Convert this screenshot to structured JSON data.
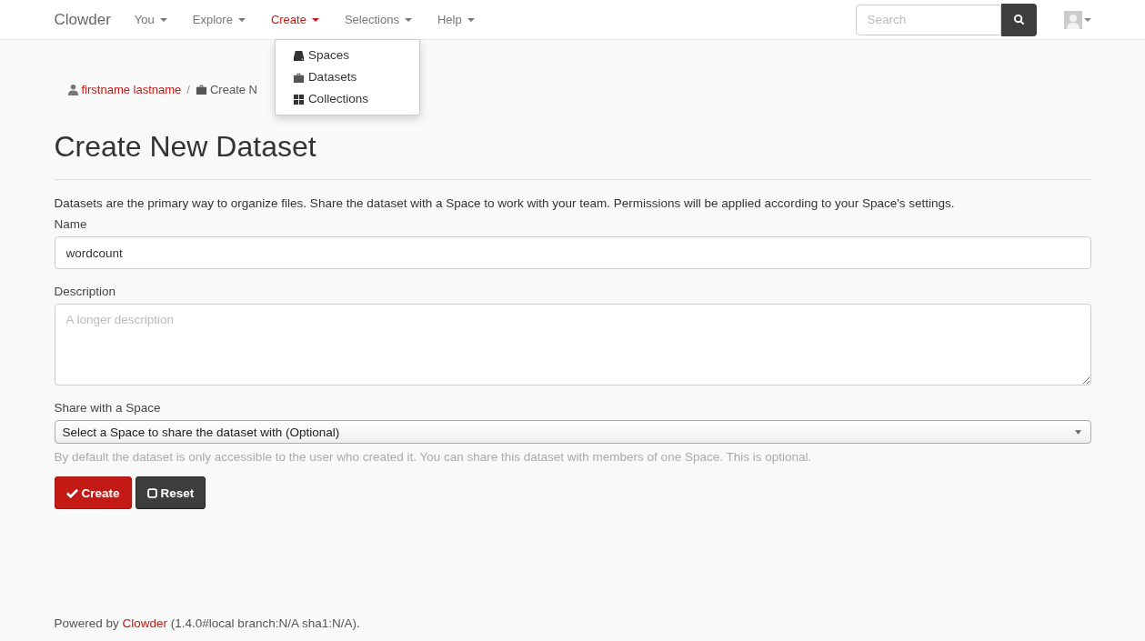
{
  "navbar": {
    "brand": "Clowder",
    "items": [
      {
        "label": "You",
        "selected": false
      },
      {
        "label": "Explore",
        "selected": false
      },
      {
        "label": "Create",
        "selected": true,
        "menu": [
          {
            "label": "Spaces"
          },
          {
            "label": "Datasets"
          },
          {
            "label": "Collections"
          }
        ]
      },
      {
        "label": "Selections",
        "selected": false
      },
      {
        "label": "Help",
        "selected": false
      }
    ],
    "search": {
      "placeholder": "Search"
    }
  },
  "breadcrumb": {
    "user": "firstname lastname",
    "separator": "/",
    "current": "Create N"
  },
  "title": "Create New Dataset",
  "intro": "Datasets are the primary way to organize files. Share the dataset with a Space to work with your team. Permissions will be applied according to your Space's settings.",
  "form": {
    "name": {
      "label": "Name",
      "value": "wordcount"
    },
    "description": {
      "label": "Description",
      "placeholder": "A longer description"
    },
    "space": {
      "label": "Share with a Space",
      "value": "Select a Space to share the dataset with (Optional)",
      "help": "By default the dataset is only accessible to the user who created it. You can share this dataset with members of one Space. This is optional."
    },
    "buttons": [
      {
        "label": "Create",
        "kind": "primary"
      },
      {
        "label": "Reset",
        "kind": "secondary"
      }
    ]
  },
  "footer": {
    "before": "Powered by",
    "link": "Clowder",
    "after": "(1.4.0#local branch:N/A sha1:N/A)."
  }
}
